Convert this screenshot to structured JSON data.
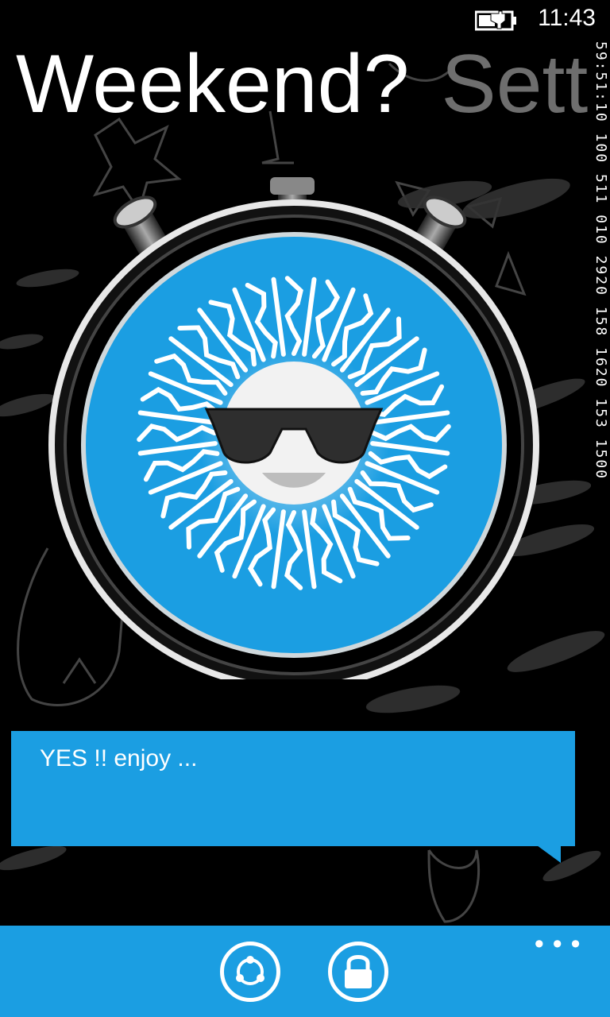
{
  "status_bar": {
    "time": "11:43",
    "battery_icon": "battery-charging-icon"
  },
  "pivot": {
    "current": "Weekend?",
    "next": "Sett"
  },
  "side_strip": {
    "text": "59:51:10 100 511 010 2920 158 1620 153 1500"
  },
  "stopwatch": {
    "icon": "sun-with-sunglasses-icon",
    "face_color": "#1b9ee2"
  },
  "message": {
    "text": "YES !! enjoy ..."
  },
  "app_bar": {
    "refresh_icon": "refresh-icon",
    "lock_icon": "lock-icon",
    "more_label": "•••",
    "color": "#1b9ee2"
  }
}
